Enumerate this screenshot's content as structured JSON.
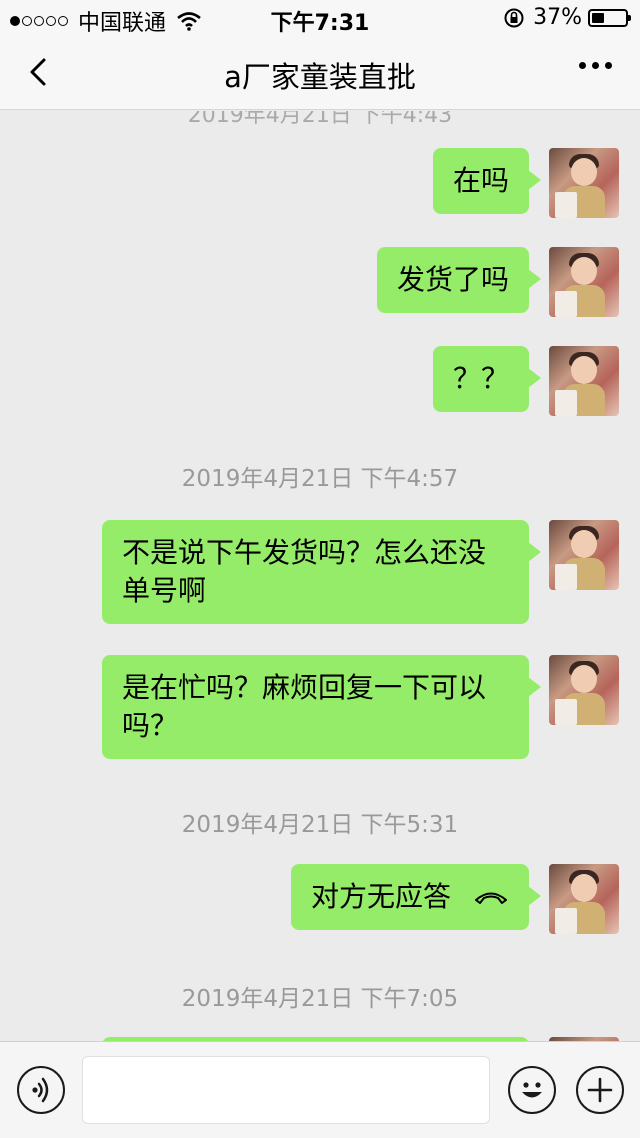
{
  "status": {
    "carrier": "中国联通",
    "time": "下午7:31",
    "battery_text": "37%",
    "battery_level": 0.37,
    "signal_bars_filled": 1,
    "signal_bars_total": 5
  },
  "nav": {
    "title": "a厂家童装直批",
    "back_icon": "chevron-left-icon",
    "more_icon": "more-dots-icon"
  },
  "chat": {
    "top_timestamp_partial": "2019年4月21日 下午4:43",
    "messages": [
      {
        "text": "在吗"
      },
      {
        "text": "发货了吗"
      },
      {
        "text": "？？"
      }
    ],
    "timestamp_1": "2019年4月21日 下午4:57",
    "messages_2": [
      {
        "line1": "不是说下午发货吗？怎么还没",
        "line2": "单号啊"
      },
      {
        "line1": "是在忙吗？麻烦回复一下可以",
        "line2": "吗？"
      }
    ],
    "timestamp_2": "2019年4月21日 下午5:31",
    "call": {
      "text": "对方无应答",
      "icon": "hang-up-phone-icon"
    },
    "timestamp_3": "2019年4月21日 下午7:05"
  },
  "input_bar": {
    "voice_icon": "voice-icon",
    "emoji_icon": "emoji-icon",
    "plus_icon": "plus-icon",
    "input_value": ""
  },
  "colors": {
    "bubble": "#95ec69",
    "background": "#ebebeb",
    "timestamp": "#999999"
  }
}
